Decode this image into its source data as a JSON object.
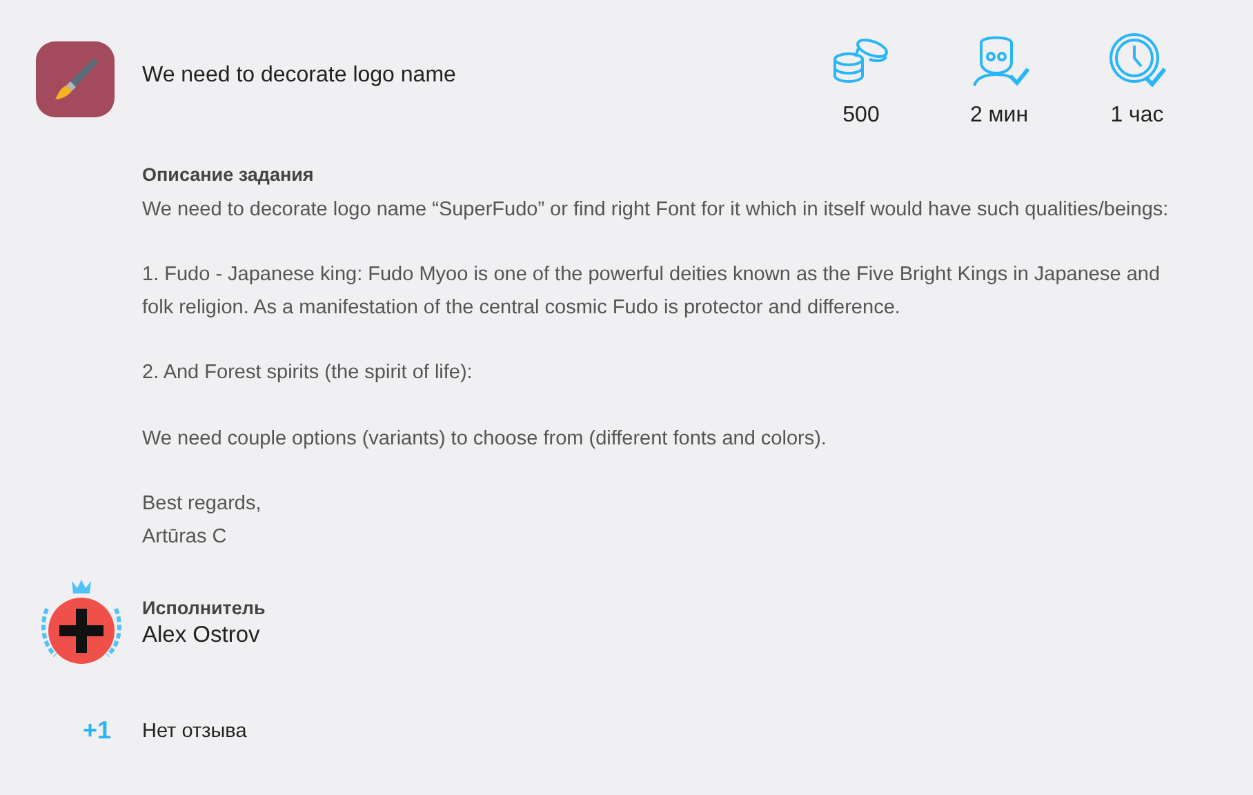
{
  "task": {
    "title": "We need to decorate logo name"
  },
  "stats": [
    {
      "kind": "coins",
      "value": "500"
    },
    {
      "kind": "person",
      "value": "2 мин"
    },
    {
      "kind": "clock",
      "value": "1 час"
    }
  ],
  "description": {
    "heading": "Описание задания",
    "paragraphs": [
      "We need to decorate logo name “SuperFudo” or find right Font for it which in itself would have such qualities/beings:",
      "1. Fudo - Japanese king: Fudo Myoo is one of the powerful deities known as the Five Bright Kings in Japanese and folk religion. As a manifestation of the central cosmic Fudo is protector and difference.",
      "2. And Forest spirits (the spirit of life):",
      "We need couple options (variants) to choose from (different fonts and colors)."
    ],
    "signature": [
      "Best regards,",
      "Artūras C"
    ]
  },
  "performer": {
    "label": "Исполнитель",
    "name": "Alex Ostrov"
  },
  "review": {
    "score": "+1",
    "text": "Нет отзыва"
  }
}
